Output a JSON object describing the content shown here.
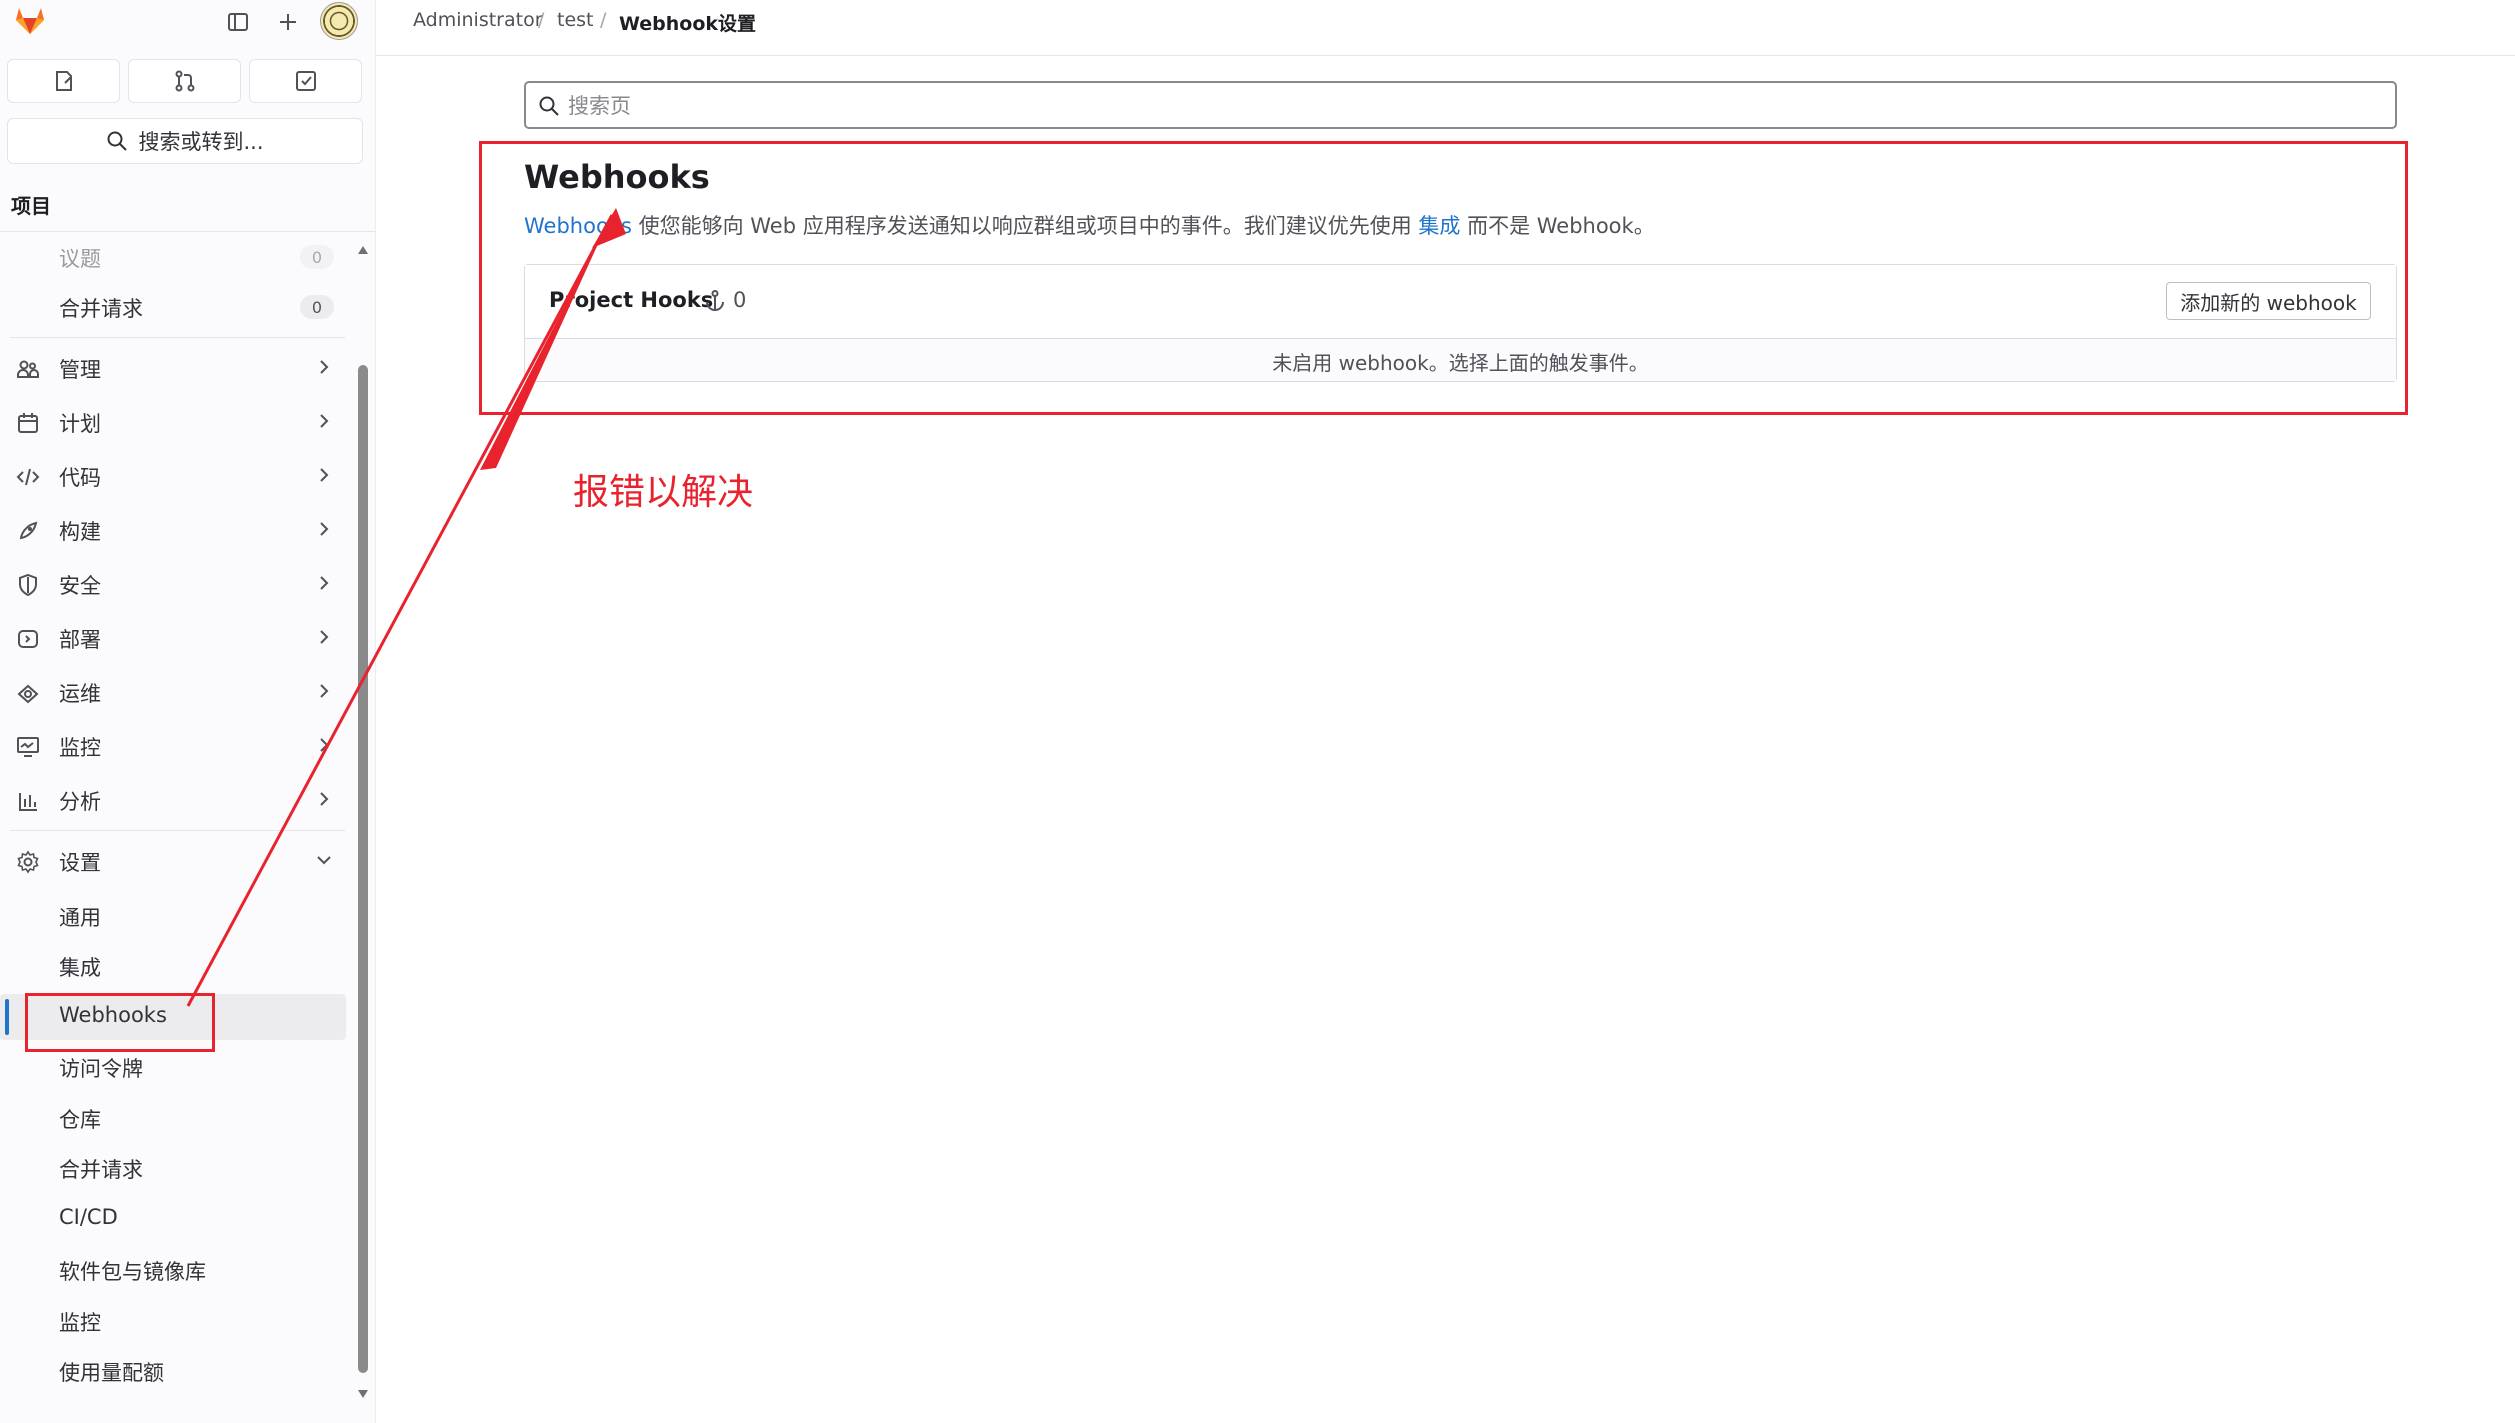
{
  "sidebar": {
    "search_label": "搜索或转到...",
    "section_title": "项目",
    "subitems": [
      {
        "label": "议题",
        "count": "0"
      },
      {
        "label": "合并请求",
        "count": "0"
      }
    ],
    "nav": [
      {
        "label": "管理",
        "icon": "users-icon"
      },
      {
        "label": "计划",
        "icon": "calendar-icon"
      },
      {
        "label": "代码",
        "icon": "code-icon"
      },
      {
        "label": "构建",
        "icon": "rocket-icon"
      },
      {
        "label": "安全",
        "icon": "shield-icon"
      },
      {
        "label": "部署",
        "icon": "deploy-icon"
      },
      {
        "label": "运维",
        "icon": "cloud-icon"
      },
      {
        "label": "监控",
        "icon": "monitor-icon"
      },
      {
        "label": "分析",
        "icon": "chart-icon"
      }
    ],
    "settings": {
      "label": "设置",
      "items": [
        "通用",
        "集成",
        "Webhooks",
        "访问令牌",
        "仓库",
        "合并请求",
        "CI/CD",
        "软件包与镜像库",
        "监控",
        "使用量配额"
      ],
      "active_index": 2
    }
  },
  "breadcrumb": [
    "Administrator",
    "test",
    "Webhook设置"
  ],
  "main": {
    "search_placeholder": "搜索页",
    "title": "Webhooks",
    "desc_link": "Webhooks",
    "desc_text1": " 使您能够向 Web 应用程序发送通知以响应群组或项目中的事件。我们建议优先使用 ",
    "desc_link2": "集成",
    "desc_text2": " 而不是 Webhook。",
    "hooks_title": "Project Hooks",
    "hooks_count": "0",
    "add_button": "添加新的 webhook",
    "empty_text": "未启用 webhook。选择上面的触发事件。"
  },
  "annotation": {
    "text": "报错以解决",
    "color": "#e8232d"
  },
  "colors": {
    "accent": "#1f75cb",
    "annotation_red": "#e8232d"
  }
}
